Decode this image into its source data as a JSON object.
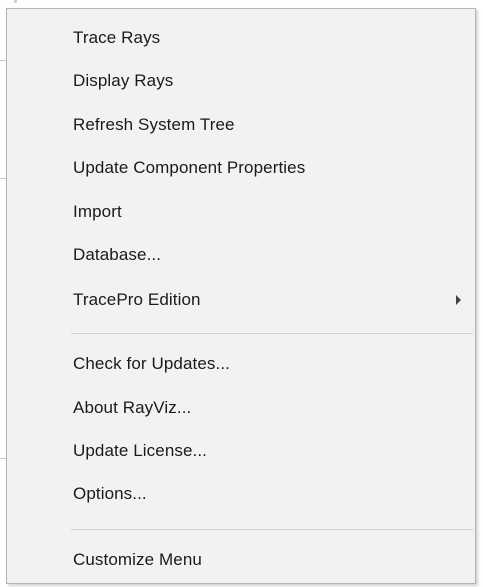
{
  "menu": {
    "items": [
      {
        "label": "Trace Rays"
      },
      {
        "label": "Display Rays"
      },
      {
        "label": "Refresh System Tree"
      },
      {
        "label": "Update Component Properties"
      },
      {
        "label": "Import"
      },
      {
        "label": "Database..."
      },
      {
        "label": "TracePro Edition",
        "submenu": true
      },
      {
        "label": "Check for Updates..."
      },
      {
        "label": "About RayViz..."
      },
      {
        "label": "Update License..."
      },
      {
        "label": "Options..."
      },
      {
        "label": "Customize Menu"
      }
    ]
  },
  "colors": {
    "menu_background": "#f2f2f2",
    "menu_border": "#b4b4b4",
    "text": "#1a1a1a",
    "separator": "#d2d2d2"
  },
  "icons": {
    "submenu_arrow": "chevron-right-icon"
  }
}
